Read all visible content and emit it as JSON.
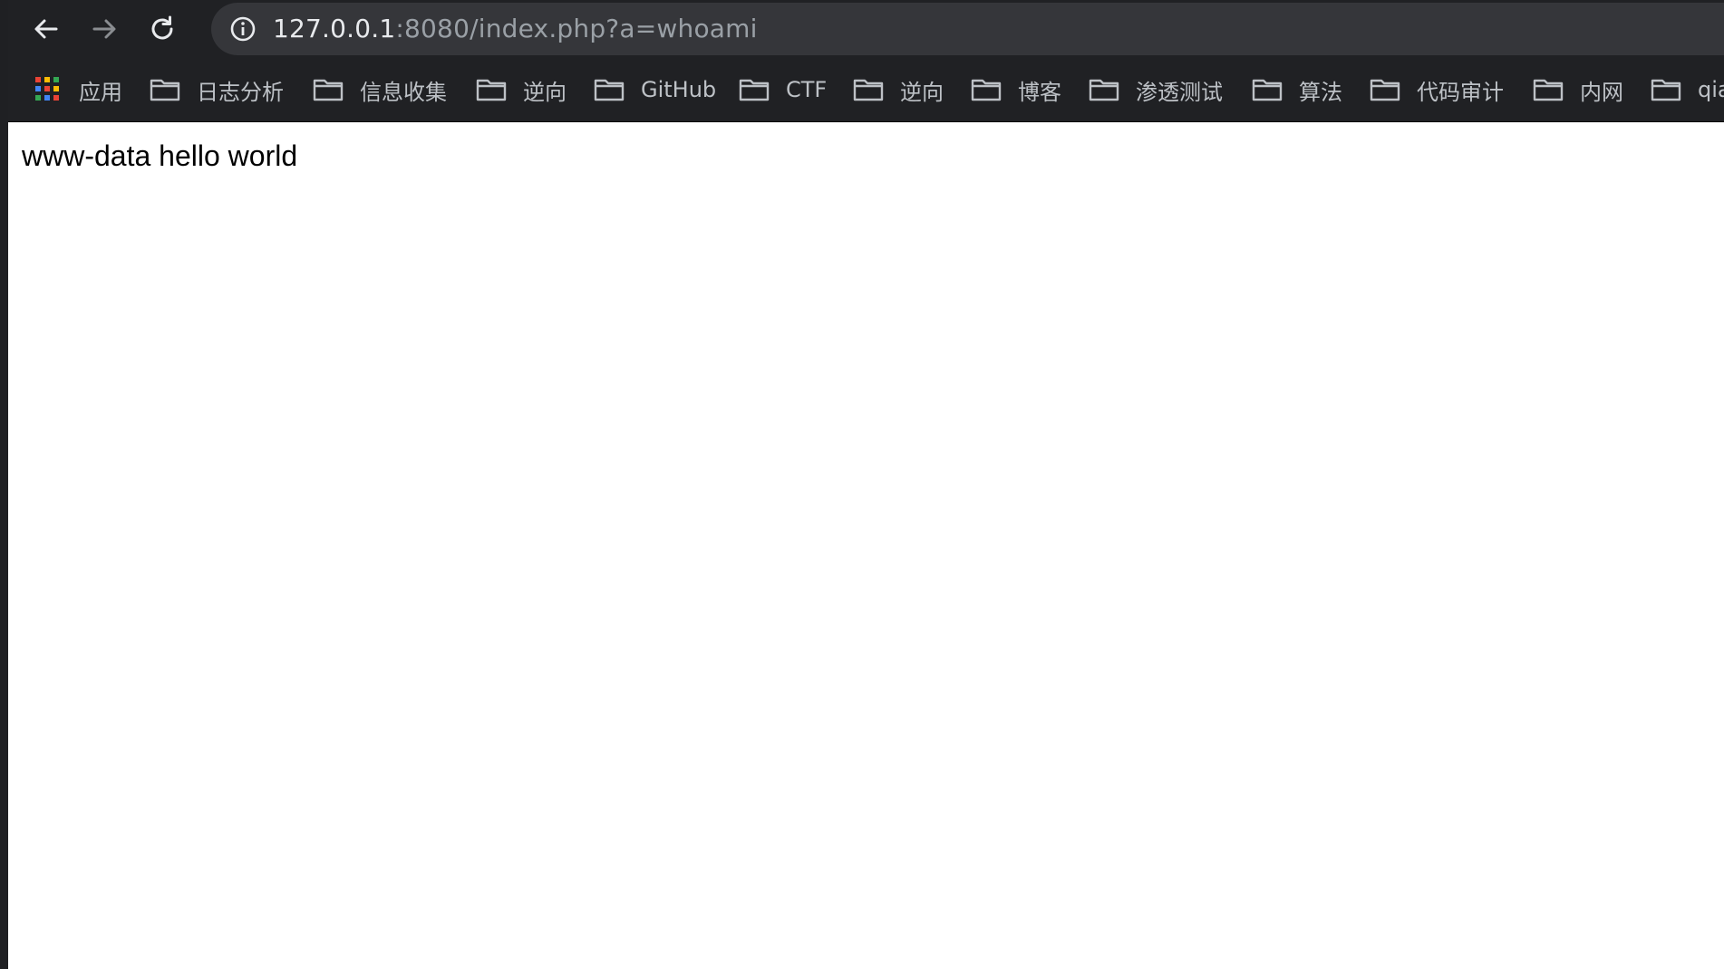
{
  "browser": {
    "address_bar": {
      "host": "127.0.0.1",
      "rest": ":8080/index.php?a=whoami"
    },
    "bookmarks": [
      {
        "label": "应用",
        "icon": "apps-grid-icon"
      },
      {
        "label": "日志分析",
        "icon": "folder-icon"
      },
      {
        "label": "信息收集",
        "icon": "folder-icon"
      },
      {
        "label": "逆向",
        "icon": "folder-icon"
      },
      {
        "label": "GitHub",
        "icon": "folder-icon"
      },
      {
        "label": "CTF",
        "icon": "folder-icon"
      },
      {
        "label": "逆向",
        "icon": "folder-icon"
      },
      {
        "label": "博客",
        "icon": "folder-icon"
      },
      {
        "label": "渗透测试",
        "icon": "folder-icon"
      },
      {
        "label": "算法",
        "icon": "folder-icon"
      },
      {
        "label": "代码审计",
        "icon": "folder-icon"
      },
      {
        "label": "内网",
        "icon": "folder-icon"
      },
      {
        "label": "qia",
        "icon": "folder-icon"
      }
    ]
  },
  "page": {
    "output": "www-data hello world"
  },
  "colors": {
    "toolbar_bg": "#202124",
    "omnibox_bg": "#35363a",
    "host_text": "#e8eaed",
    "url_dim_text": "#9aa0a6",
    "bookmark_text": "#bdc1c6"
  }
}
